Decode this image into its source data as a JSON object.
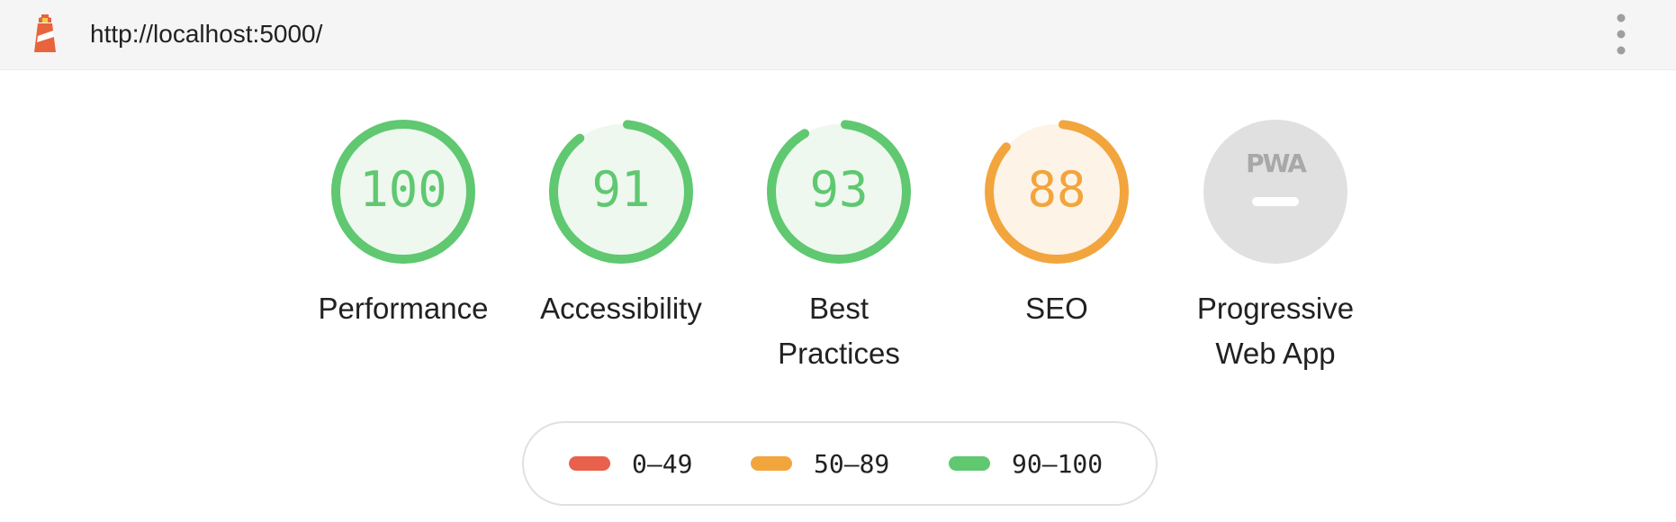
{
  "topbar": {
    "url": "http://localhost:5000/",
    "logo_icon": "lighthouse-icon",
    "menu_icon": "kebab-menu-icon"
  },
  "colors": {
    "pass": "#5fc870",
    "pass_bg": "#eef8ef",
    "average": "#f2a53d",
    "average_bg": "#fdf3e7",
    "fail": "#e9604d",
    "na": "#e0e0e0"
  },
  "gauges": [
    {
      "key": "performance",
      "score": "100",
      "score_value": 100,
      "label": "Performance",
      "status": "pass"
    },
    {
      "key": "accessibility",
      "score": "91",
      "score_value": 91,
      "label": "Accessibility",
      "status": "pass"
    },
    {
      "key": "best-practices",
      "score": "93",
      "score_value": 93,
      "label_line1": "Best",
      "label_line2": "Practices",
      "status": "pass"
    },
    {
      "key": "seo",
      "score": "88",
      "score_value": 88,
      "label": "SEO",
      "status": "average"
    }
  ],
  "pwa": {
    "badge_text": "PWA",
    "label_line1": "Progressive",
    "label_line2": "Web App"
  },
  "legend": {
    "fail": "0–49",
    "average": "50–89",
    "pass": "90–100"
  }
}
